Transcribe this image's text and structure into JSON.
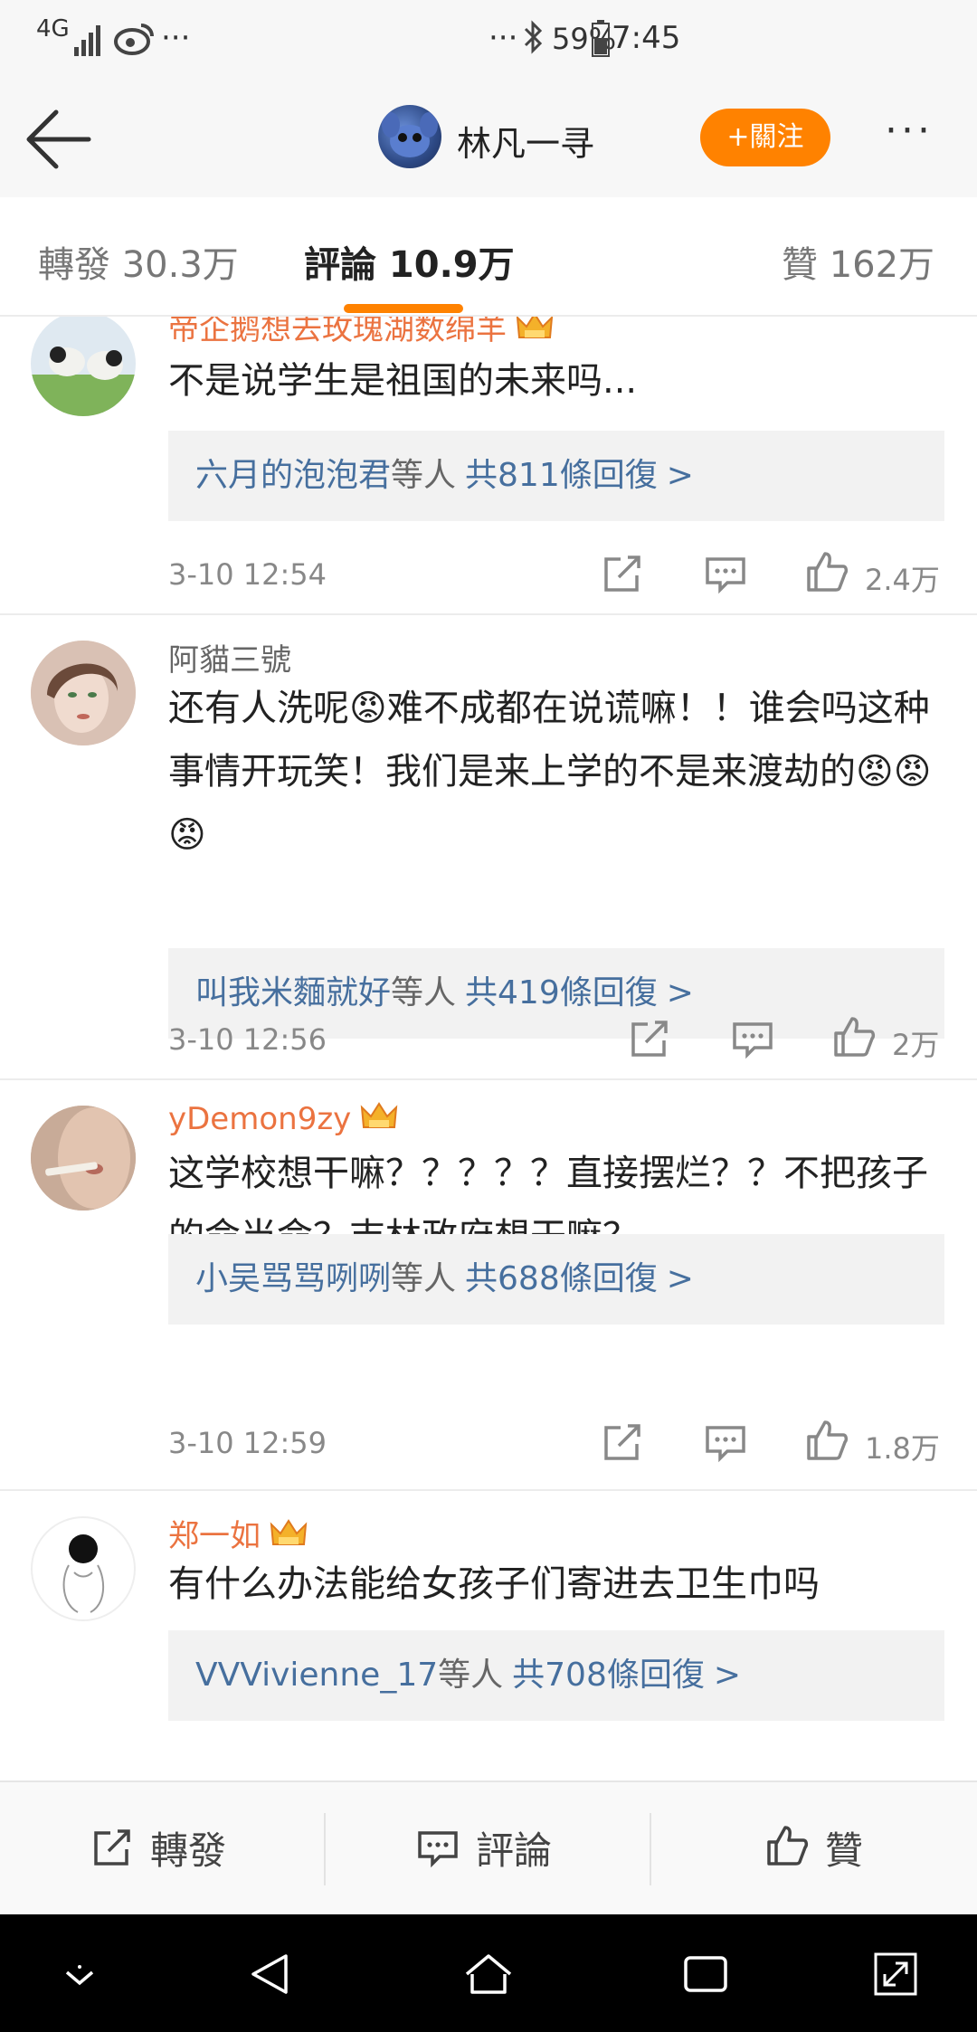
{
  "status_bar": {
    "network": "4G",
    "more_left": "···",
    "more_right": "···",
    "battery": "59%",
    "time": "7:45"
  },
  "header": {
    "username": "林凡一寻",
    "follow_label": "+關注",
    "more_label": "···"
  },
  "tabs": {
    "reposts": "轉發 30.3万",
    "comments": "評論 10.9万",
    "likes": "贊 162万"
  },
  "comments": [
    {
      "username": "帝企鹅想去玫瑰湖数绵羊",
      "vip": true,
      "text": "不是说学生是祖国的未来吗...",
      "reply_user": "六月的泡泡君",
      "reply_others": "等人",
      "reply_count": "共811條回復",
      "time": "3-10 12:54",
      "likes": "2.4万"
    },
    {
      "username": "阿貓三號",
      "vip": false,
      "text": "还有人洗呢😡难不成都在说谎嘛！！谁会吗这种事情开玩笑！我们是来上学的不是来渡劫的😡😡😡",
      "reply_user": "叫我米麵就好",
      "reply_others": "等人",
      "reply_count": "共419條回復",
      "time": "3-10 12:56",
      "likes": "2万"
    },
    {
      "username": "yDemon9zy",
      "vip": true,
      "text": "这学校想干嘛？？？？？直接摆烂？？不把孩子的命当命？吉林政府想干嘛？",
      "reply_user": "小吴骂骂咧咧",
      "reply_others": "等人",
      "reply_count": "共688條回復",
      "time": "3-10 12:59",
      "likes": "1.8万"
    },
    {
      "username": "郑一如",
      "vip": true,
      "text": "有什么办法能给女孩子们寄进去卫生巾吗",
      "reply_user": "VVVivienne_17",
      "reply_others": "等人",
      "reply_count": "共708條回復",
      "time": "",
      "likes": ""
    }
  ],
  "reply_chevron": ">",
  "bottom_bar": {
    "repost": "轉發",
    "comment": "評論",
    "like": "贊"
  },
  "colors": {
    "accent": "#ff8200",
    "link": "#466f9e",
    "vip_name": "#eb7340"
  }
}
